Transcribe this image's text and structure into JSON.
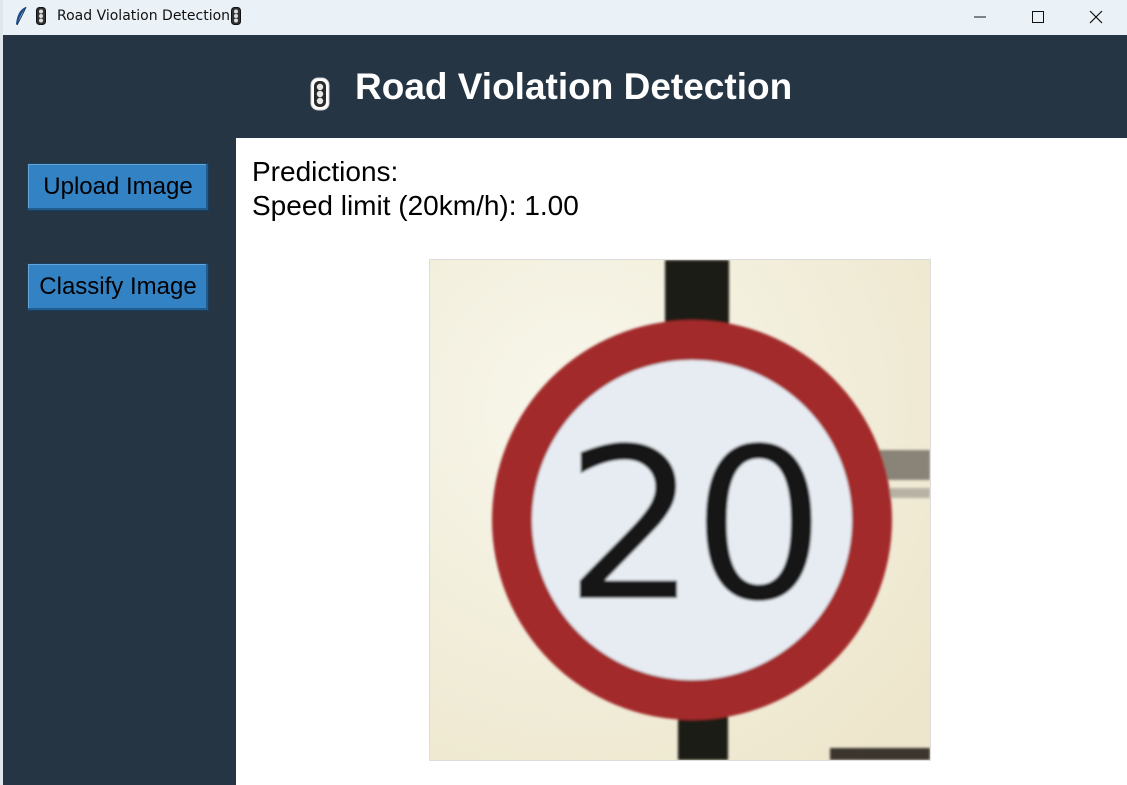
{
  "window": {
    "title": "Road Violation Detection",
    "controls": {
      "minimize": "minimize-icon",
      "maximize": "maximize-icon",
      "close": "close-icon"
    }
  },
  "header": {
    "title": "Road Violation Detection",
    "icon": "traffic-light-icon"
  },
  "sidebar": {
    "upload_label": "Upload Image",
    "classify_label": "Classify Image"
  },
  "main": {
    "predictions_heading": "Predictions:",
    "prediction_line": "Speed limit (20km/h): 1.00",
    "image": {
      "subject": "speed-limit-sign",
      "sign_number": "20"
    }
  },
  "colors": {
    "background": "#263544",
    "button": "#3282c4",
    "panel": "#ffffff",
    "titlebar": "#eaf2f8",
    "sign_red": "#a32a29"
  }
}
